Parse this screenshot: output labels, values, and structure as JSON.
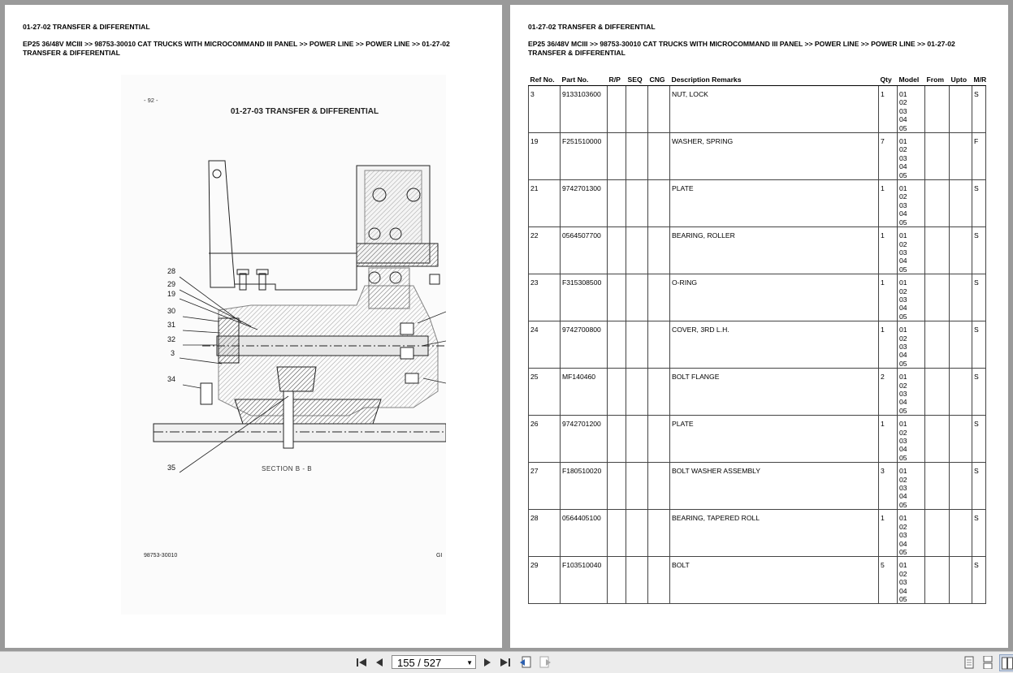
{
  "left_page": {
    "section_title": "01-27-02 TRANSFER & DIFFERENTIAL",
    "breadcrumb": "EP25 36/48V MCIII >> 98753-30010 CAT TRUCKS WITH MICROCOMMAND III PANEL >> POWER LINE >> POWER LINE >> 01-27-02 TRANSFER & DIFFERENTIAL",
    "figure": {
      "page_no": "- 92 -",
      "title": "01-27-03 TRANSFER & DIFFERENTIAL",
      "section_label": "SECTION B - B",
      "code": "98753-30010",
      "tag": "GI",
      "callouts": [
        "28",
        "29",
        "19",
        "30",
        "31",
        "32",
        "3",
        "34",
        "35"
      ]
    }
  },
  "right_page": {
    "section_title": "01-27-02 TRANSFER & DIFFERENTIAL",
    "breadcrumb": "EP25 36/48V MCIII >> 98753-30010 CAT TRUCKS WITH MICROCOMMAND III PANEL >> POWER LINE >> POWER LINE >> 01-27-02 TRANSFER & DIFFERENTIAL",
    "table": {
      "headers": [
        "Ref No.",
        "Part No.",
        "R/P",
        "SEQ",
        "CNG",
        "Description Remarks",
        "Qty",
        "Model",
        "From",
        "Upto",
        "M/R"
      ],
      "rows": [
        {
          "ref": "3",
          "part": "9133103600",
          "rp": "",
          "seq": "",
          "cng": "",
          "desc": "NUT, LOCK",
          "qty": "1",
          "models": "01\n02\n03\n04\n05",
          "from": "",
          "upto": "",
          "mr": "S"
        },
        {
          "ref": "19",
          "part": "F251510000",
          "rp": "",
          "seq": "",
          "cng": "",
          "desc": "WASHER, SPRING",
          "qty": "7",
          "models": "01\n02\n03\n04\n05",
          "from": "",
          "upto": "",
          "mr": "F"
        },
        {
          "ref": "21",
          "part": "9742701300",
          "rp": "",
          "seq": "",
          "cng": "",
          "desc": "PLATE",
          "qty": "1",
          "models": "01\n02\n03\n04\n05",
          "from": "",
          "upto": "",
          "mr": "S"
        },
        {
          "ref": "22",
          "part": "0564507700",
          "rp": "",
          "seq": "",
          "cng": "",
          "desc": "BEARING, ROLLER",
          "qty": "1",
          "models": "01\n02\n03\n04\n05",
          "from": "",
          "upto": "",
          "mr": "S"
        },
        {
          "ref": "23",
          "part": "F315308500",
          "rp": "",
          "seq": "",
          "cng": "",
          "desc": "O-RING",
          "qty": "1",
          "models": "01\n02\n03\n04\n05",
          "from": "",
          "upto": "",
          "mr": "S"
        },
        {
          "ref": "24",
          "part": "9742700800",
          "rp": "",
          "seq": "",
          "cng": "",
          "desc": "COVER, 3RD L.H.",
          "qty": "1",
          "models": "01\n02\n03\n04\n05",
          "from": "",
          "upto": "",
          "mr": "S"
        },
        {
          "ref": "25",
          "part": "MF140460",
          "rp": "",
          "seq": "",
          "cng": "",
          "desc": "BOLT FLANGE",
          "qty": "2",
          "models": "01\n02\n03\n04\n05",
          "from": "",
          "upto": "",
          "mr": "S"
        },
        {
          "ref": "26",
          "part": "9742701200",
          "rp": "",
          "seq": "",
          "cng": "",
          "desc": "PLATE",
          "qty": "1",
          "models": "01\n02\n03\n04\n05",
          "from": "",
          "upto": "",
          "mr": "S"
        },
        {
          "ref": "27",
          "part": "F180510020",
          "rp": "",
          "seq": "",
          "cng": "",
          "desc": "BOLT WASHER ASSEMBLY",
          "qty": "3",
          "models": "01\n02\n03\n04\n05",
          "from": "",
          "upto": "",
          "mr": "S"
        },
        {
          "ref": "28",
          "part": "0564405100",
          "rp": "",
          "seq": "",
          "cng": "",
          "desc": "BEARING, TAPERED ROLL",
          "qty": "1",
          "models": "01\n02\n03\n04\n05",
          "from": "",
          "upto": "",
          "mr": "S"
        },
        {
          "ref": "29",
          "part": "F103510040",
          "rp": "",
          "seq": "",
          "cng": "",
          "desc": "BOLT",
          "qty": "5",
          "models": "01\n02\n03\n04\n05",
          "from": "",
          "upto": "",
          "mr": "S"
        }
      ]
    }
  },
  "toolbar": {
    "page_indicator": "155 / 527",
    "icons": [
      "first-page-icon",
      "prev-page-icon",
      "next-page-icon",
      "last-page-icon",
      "previous-view-icon",
      "next-view-icon",
      "single-page-icon",
      "continuous-icon",
      "two-page-icon"
    ]
  }
}
